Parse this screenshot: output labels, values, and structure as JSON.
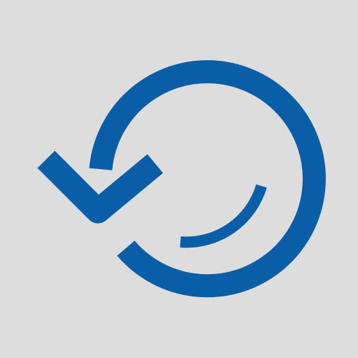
{
  "icon": {
    "name": "undo-restore-icon",
    "background_color": "#dddddd",
    "accent_color": "#0a5ea8"
  }
}
